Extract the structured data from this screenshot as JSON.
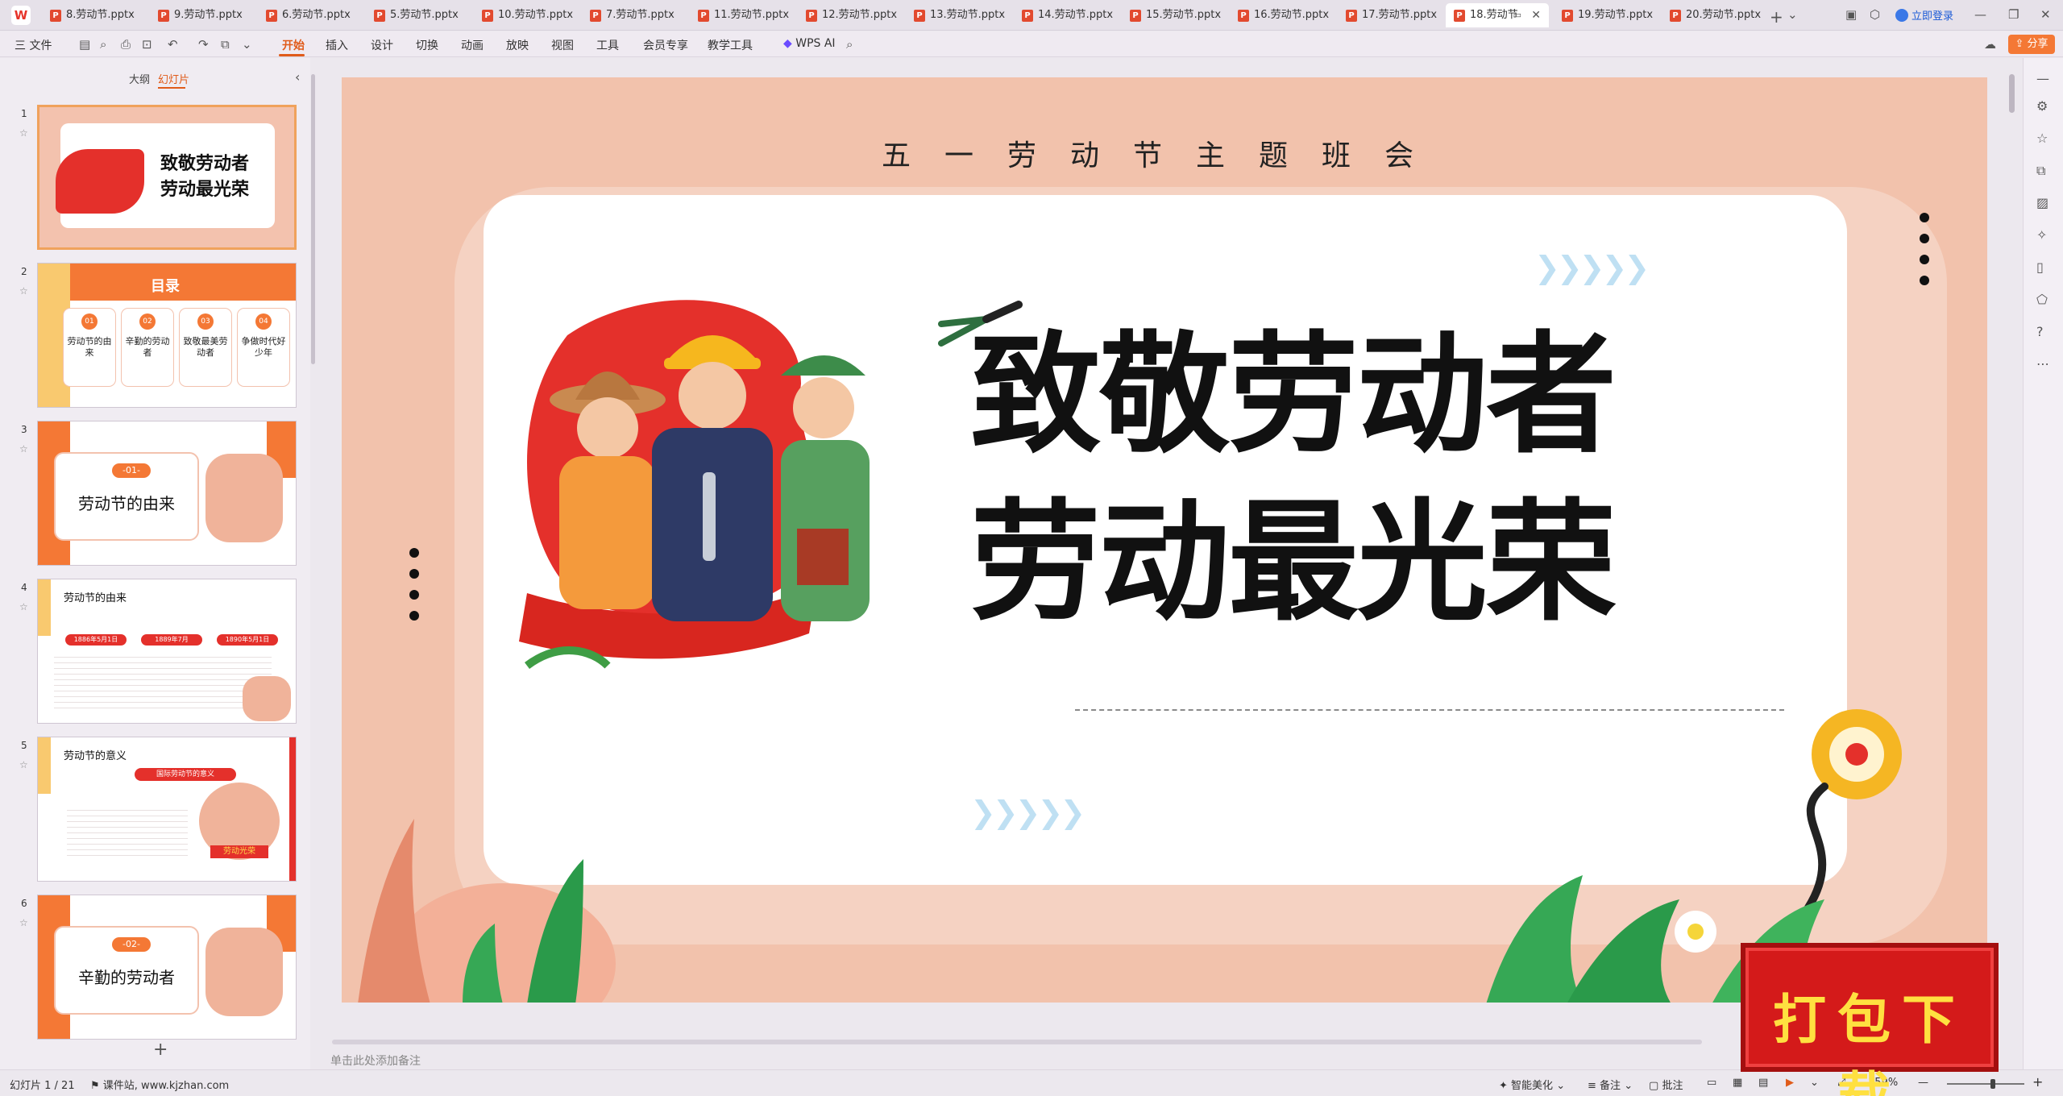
{
  "app": {
    "logo": "W"
  },
  "tabs": [
    {
      "label": "8.劳动节.pptx",
      "active": false
    },
    {
      "label": "9.劳动节.pptx",
      "active": false
    },
    {
      "label": "6.劳动节.pptx",
      "active": false
    },
    {
      "label": "5.劳动节.pptx",
      "active": false
    },
    {
      "label": "10.劳动节.pptx",
      "active": false
    },
    {
      "label": "7.劳动节.pptx",
      "active": false
    },
    {
      "label": "11.劳动节.pptx",
      "active": false
    },
    {
      "label": "12.劳动节.pptx",
      "active": false
    },
    {
      "label": "13.劳动节.pptx",
      "active": false
    },
    {
      "label": "14.劳动节.pptx",
      "active": false
    },
    {
      "label": "15.劳动节.pptx",
      "active": false
    },
    {
      "label": "16.劳动节.pptx",
      "active": false
    },
    {
      "label": "17.劳动节.pptx",
      "active": false
    },
    {
      "label": "18.劳动节",
      "active": true
    },
    {
      "label": "19.劳动节.pptx",
      "active": false
    },
    {
      "label": "20.劳动节.pptx",
      "active": false
    }
  ],
  "titlebar": {
    "login": "立即登录",
    "new_tab": "+"
  },
  "ribbon": {
    "file": "三 文件",
    "tabs": [
      "开始",
      "插入",
      "设计",
      "切换",
      "动画",
      "放映",
      "视图",
      "工具",
      "会员专享",
      "教学工具"
    ],
    "active_tab": "开始",
    "wps_ai": "WPS AI",
    "share": "分享"
  },
  "left_panel": {
    "tab_outline": "大纲",
    "tab_slides": "幻灯片",
    "add": "+",
    "thumbs": [
      {
        "num": "1",
        "line1": "致敬劳动者",
        "line2": "劳动最光荣"
      },
      {
        "num": "2",
        "title": "目录",
        "items": [
          "劳动节的由来",
          "辛勤的劳动者",
          "致敬最美劳动者",
          "争做时代好少年"
        ],
        "nums": [
          "01",
          "02",
          "03",
          "04"
        ]
      },
      {
        "num": "3",
        "badge": "-01-",
        "title": "劳动节的由来"
      },
      {
        "num": "4",
        "title": "劳动节的由来",
        "dates": [
          "1886年5月1日",
          "1889年7月",
          "1890年5月1日"
        ]
      },
      {
        "num": "5",
        "title": "劳动节的意义",
        "badge": "国际劳动节的意义",
        "tag": "劳动光荣"
      },
      {
        "num": "6",
        "badge": "-02-",
        "title": "辛勤的劳动者"
      }
    ]
  },
  "slide": {
    "subtitle": "五一劳动节主题班会",
    "line1": "致敬劳动者",
    "line2": "劳动最光荣"
  },
  "notes_placeholder": "单击此处添加备注",
  "status": {
    "slide_info": "幻灯片 1 / 21",
    "source": "课件站, www.kjzhan.com",
    "beautify": "智能美化",
    "notes": "备注",
    "comment": "批注",
    "zoom": "159%"
  },
  "download_badge": "打包下载",
  "colors": {
    "accent": "#e05b1a",
    "slide_bg": "#f2c2ac",
    "red": "#e4302b",
    "orange": "#f47835"
  }
}
